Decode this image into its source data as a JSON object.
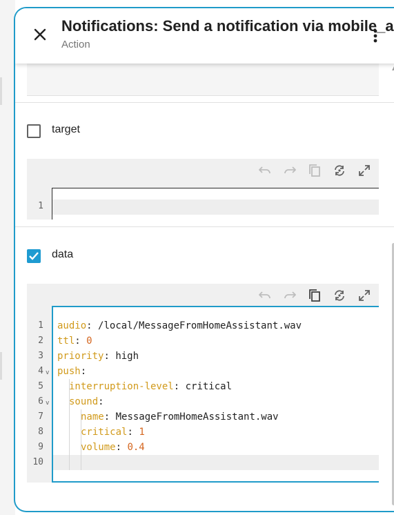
{
  "header": {
    "title": "Notifications: Send a notification via mobile_app",
    "subtitle": "Action"
  },
  "fields": [
    {
      "label": "target",
      "checked": false,
      "lines": [
        ""
      ]
    },
    {
      "label": "data",
      "checked": true
    }
  ],
  "editor_data": {
    "line_numbers": [
      "1",
      "2",
      "3",
      "4",
      "5",
      "6",
      "7",
      "8",
      "9",
      "10"
    ],
    "lines": [
      {
        "key": "audio",
        "value": "/local/MessageFromHomeAssistant.wav",
        "indent": 0
      },
      {
        "key": "ttl",
        "value": "0",
        "indent": 0
      },
      {
        "key": "priority",
        "value": "high",
        "indent": 0
      },
      {
        "key": "push",
        "value": "",
        "indent": 0,
        "foldable": true
      },
      {
        "key": "interruption-level",
        "value": "critical",
        "indent": 1
      },
      {
        "key": "sound",
        "value": "",
        "indent": 1,
        "foldable": true
      },
      {
        "key": "name",
        "value": "MessageFromHomeAssistant.wav",
        "indent": 2
      },
      {
        "key": "critical",
        "value": "1",
        "indent": 2
      },
      {
        "key": "volume",
        "value": "0.4",
        "indent": 2
      },
      {
        "key": "",
        "value": "",
        "indent": 0
      }
    ]
  },
  "icons": {
    "close": "close-icon",
    "menu": "kebab-menu-icon",
    "undo": "undo-icon",
    "redo": "redo-icon",
    "copy": "copy-icon",
    "reload": "refresh-icon",
    "fullscreen": "fullscreen-icon"
  },
  "colors": {
    "accent": "#1f9bc9",
    "yaml_key": "#d19a1b",
    "yaml_number": "#d4661f"
  }
}
